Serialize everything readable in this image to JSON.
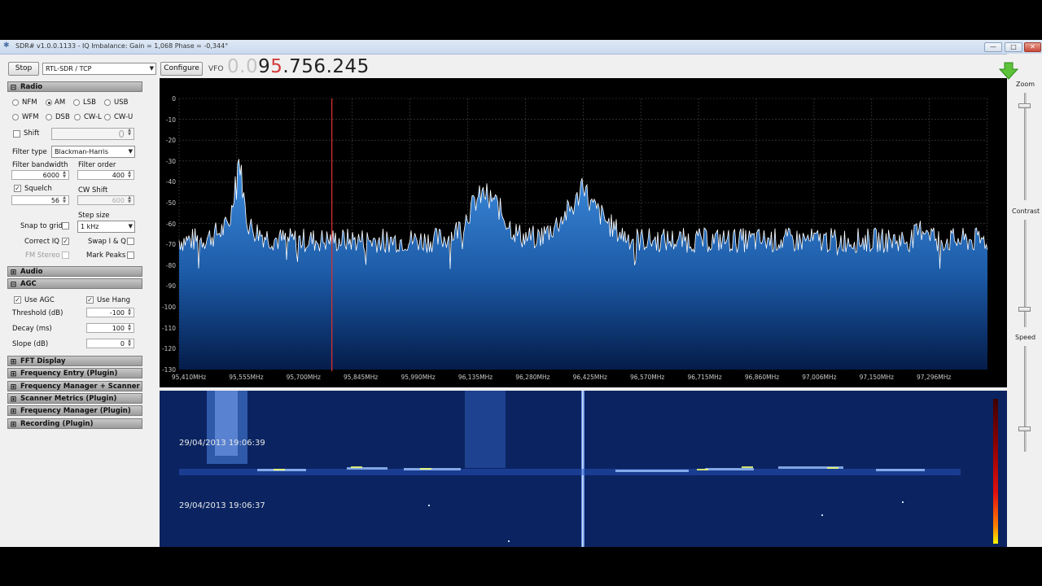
{
  "window": {
    "title": "SDR# v1.0.0.1133 - IQ Imbalance: Gain = 1,068 Phase = -0,344°",
    "controls": {
      "minimize": "—",
      "maximize": "□",
      "close": "✕"
    }
  },
  "toolbar": {
    "stop_label": "Stop",
    "source_value": "RTL-SDR / TCP",
    "configure_label": "Configure",
    "vfo_label": "VFO",
    "vfo_dim": "0.0",
    "vfo_pre": "9",
    "vfo_highlight": "5",
    "vfo_rest": ".756.245"
  },
  "radio": {
    "header": "Radio",
    "modes": [
      {
        "label": "NFM",
        "selected": false
      },
      {
        "label": "AM",
        "selected": true
      },
      {
        "label": "LSB",
        "selected": false
      },
      {
        "label": "USB",
        "selected": false
      },
      {
        "label": "WFM",
        "selected": false
      },
      {
        "label": "DSB",
        "selected": false
      },
      {
        "label": "CW-L",
        "selected": false
      },
      {
        "label": "CW-U",
        "selected": false
      }
    ],
    "shift_label": "Shift",
    "shift_value": "0",
    "filter_type_label": "Filter type",
    "filter_type_value": "Blackman-Harris",
    "filter_bandwidth_label": "Filter bandwidth",
    "filter_bandwidth_value": "6000",
    "filter_order_label": "Filter order",
    "filter_order_value": "400",
    "squelch_label": "Squelch",
    "squelch_value": "56",
    "cw_shift_label": "CW Shift",
    "cw_shift_value": "600",
    "step_size_label": "Step size",
    "step_size_value": "1 kHz",
    "snap_to_grid_label": "Snap to grid",
    "correct_iq_label": "Correct IQ",
    "swap_iq_label": "Swap I & Q",
    "fm_stereo_label": "FM Stereo",
    "mark_peaks_label": "Mark Peaks"
  },
  "audio": {
    "header": "Audio"
  },
  "agc": {
    "header": "AGC",
    "use_agc_label": "Use AGC",
    "use_hang_label": "Use Hang",
    "threshold_label": "Threshold (dB)",
    "threshold_value": "-100",
    "decay_label": "Decay (ms)",
    "decay_value": "100",
    "slope_label": "Slope (dB)",
    "slope_value": "0"
  },
  "plugins": [
    "FFT Display",
    "Frequency Entry (Plugin)",
    "Frequency Manager + Scanner (Plugin)",
    "Scanner Metrics (Plugin)",
    "Frequency Manager (Plugin)",
    "Recording (Plugin)"
  ],
  "spectrum": {
    "y_ticks": [
      "0",
      "-10",
      "-20",
      "-30",
      "-40",
      "-50",
      "-60",
      "-70",
      "-80",
      "-90",
      "-100",
      "-110",
      "-120",
      "-130"
    ],
    "x_ticks": [
      "95,410MHz",
      "95,555MHz",
      "95,700MHz",
      "95,845MHz",
      "95,990MHz",
      "96,135MHz",
      "96,280MHz",
      "96,425MHz",
      "96,570MHz",
      "96,715MHz",
      "96,860MHz",
      "97,006MHz",
      "97,150MHz",
      "97,296MHz"
    ]
  },
  "waterfall": {
    "timestamps": [
      "29/04/2013 19:06:39",
      "29/04/2013 19:06:37"
    ]
  },
  "side_controls": {
    "zoom_label": "Zoom",
    "contrast_label": "Contrast",
    "speed_label": "Speed",
    "zoom_level": 0.9,
    "contrast_level": 0.15,
    "speed_level": 0.2
  },
  "colors": {
    "spectrum_fill_top": "#3f8fe0",
    "spectrum_fill_bottom": "#041c4a",
    "waterfall_bg": "#0b2461",
    "vfo_marker": "#d23030",
    "download_arrow": "#5cc23a"
  }
}
